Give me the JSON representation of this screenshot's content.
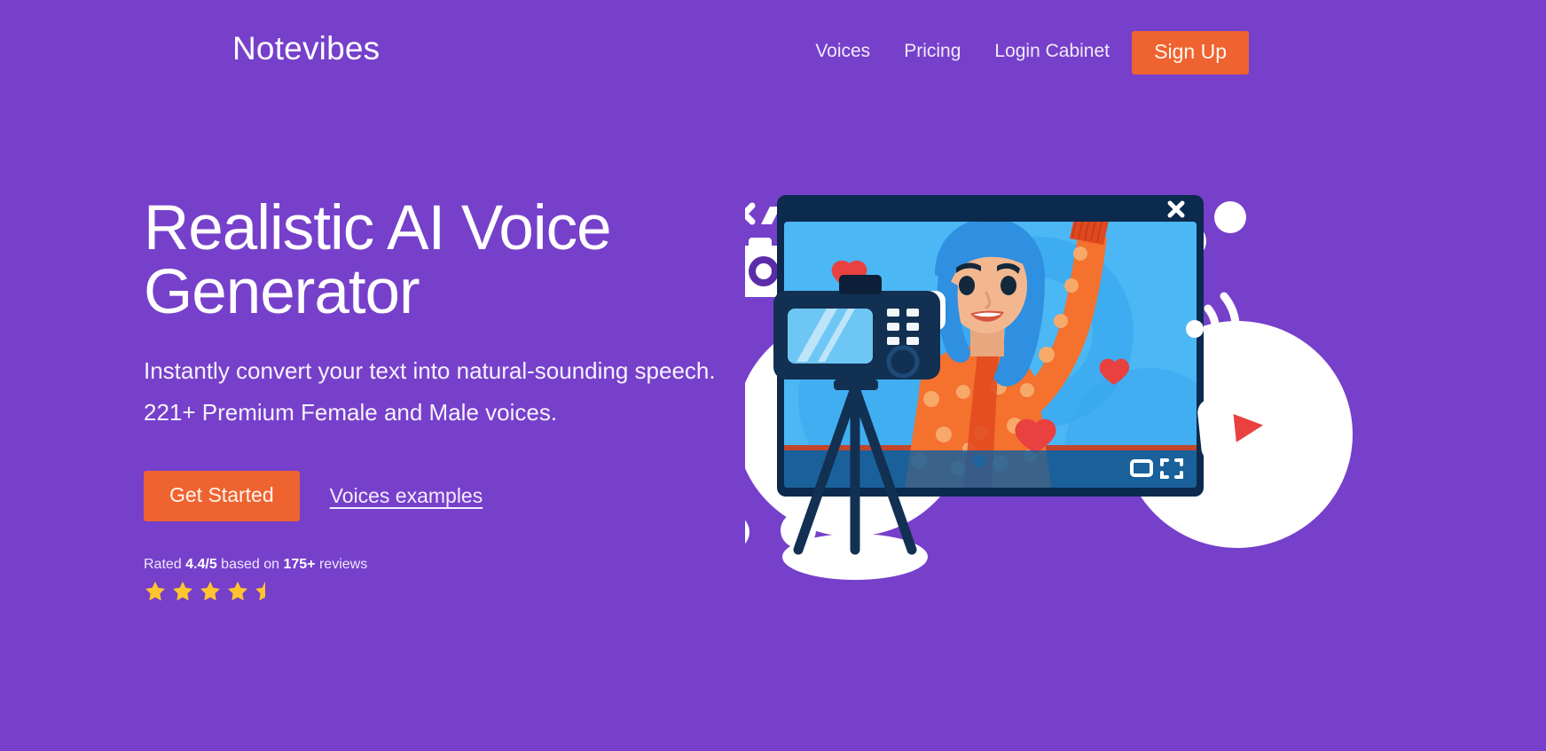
{
  "brand": {
    "name": "Notevibes",
    "purple": "#7640cb",
    "orange": "#ef6330",
    "navy": "#0c2a4d",
    "star_gold": "#ffc42e"
  },
  "header": {
    "nav_items": [
      {
        "label": "Voices",
        "name": "nav-voices"
      },
      {
        "label": "Pricing",
        "name": "nav-pricing"
      },
      {
        "label": "Login Cabinet",
        "name": "nav-login-cabinet"
      }
    ],
    "signup_label": "Sign Up"
  },
  "hero": {
    "title": "Realistic AI Voice\nGenerator",
    "subtitle": "Instantly convert your text into natural-sounding speech. 221+ Premium Female and Male voices.",
    "primary_cta": "Get Started",
    "secondary_cta": "Voices examples",
    "rating": {
      "prefix": "Rated ",
      "score": "4.4/5",
      "middle": " based on ",
      "count": "175+",
      "suffix": " reviews",
      "stars_full": 4,
      "stars_half": 1,
      "stars_total": 5
    }
  },
  "illustration": {
    "alt": "woman with blue hair waving on a video call screen with camera on tripod",
    "icons": [
      "camera-icon",
      "close-x-icon",
      "motion-lines-icon",
      "heart-icon",
      "chat-bubble-icon",
      "wifi-signal-icon",
      "play-button-icon",
      "fullscreen-icon",
      "picture-in-picture-icon"
    ]
  }
}
